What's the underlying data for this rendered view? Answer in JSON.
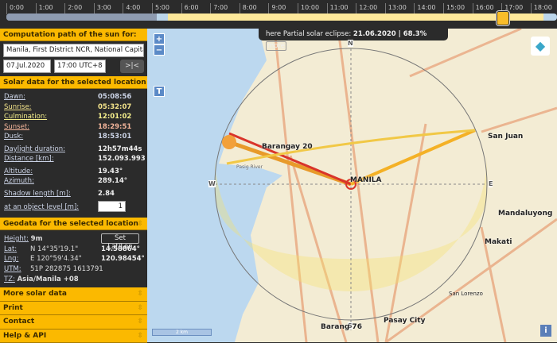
{
  "timeline": {
    "hours": [
      "0:00",
      "1:00",
      "2:00",
      "3:00",
      "4:00",
      "5:00",
      "6:00",
      "7:00",
      "8:00",
      "9:00",
      "10:00",
      "11:00",
      "12:00",
      "13:00",
      "14:00",
      "15:00",
      "16:00",
      "17:00",
      "18:00"
    ],
    "current": "17:00"
  },
  "side": {
    "path_header": "Computation path of the sun for:",
    "location": "Manila, First District NCR, National Capital Re",
    "date": "07.Jul.2020",
    "time": "17:00 UTC+8",
    "now_button": ">|<",
    "solar_header": "Solar data for the selected location",
    "solar": [
      {
        "label": "Dawn:",
        "value": "05:08:56",
        "color": "#cbd3e6"
      },
      {
        "label": "Sunrise:",
        "value": "05:32:07",
        "color": "#f3e38a"
      },
      {
        "label": "Culmination:",
        "value": "12:01:02",
        "color": "#f6f08c"
      },
      {
        "label": "Sunset:",
        "value": "18:29:51",
        "color": "#f2b49a"
      },
      {
        "label": "Dusk:",
        "value": "18:53:01",
        "color": "#cbd3e6"
      }
    ],
    "daylight_label": "Daylight duration:",
    "daylight": "12h57m44s",
    "distance_label": "Distance [km]:",
    "distance": "152.093.993",
    "altitude_label": "Altitude:",
    "altitude": "19.43°",
    "azimuth_label": "Azimuth:",
    "azimuth": "289.14°",
    "shadow_label": "Shadow length [m]:",
    "shadow": "2.84",
    "object_label": "at an object level [m]:",
    "object_level": "1",
    "geo_header": "Geodata for the selected location",
    "height_label": "Height:",
    "height": "9m",
    "setlatlon": "Set Lat/Lon",
    "lat_label": "Lat:",
    "lat_dms": "N 14°35'19.1\"",
    "lat_dec": "14.58864°",
    "lng_label": "Lng:",
    "lng_dms": "E 120°59'4.34\"",
    "lng_dec": "120.98454°",
    "utm_label": "UTM:",
    "utm": "51P 282875 1613791",
    "tz_label": "TZ:",
    "tz": "Asia/Manila  +08",
    "sections": [
      "More solar data",
      "Print",
      "Contact",
      "Help & API"
    ]
  },
  "map": {
    "eclipse_text": "here Partial solar eclipse:",
    "eclipse_value": "21.06.2020 | 68.3%",
    "more": "more",
    "zoom_in": "+",
    "zoom_out": "−",
    "t_button": "T",
    "info": "i",
    "scale": "2 km",
    "compass": {
      "n": "N",
      "s": "S",
      "e": "E",
      "w": "W"
    },
    "labels": {
      "barangay20": "Barangay 20",
      "manila": "MANILA",
      "sanjuan": "San Juan",
      "mandaluyong": "Mandaluyong",
      "makati": "Makati",
      "sanlorenzo": "San Lorenzo",
      "pasay": "Pasay City",
      "barangay76": "Barang  76",
      "pasig": "Pasig River"
    }
  }
}
